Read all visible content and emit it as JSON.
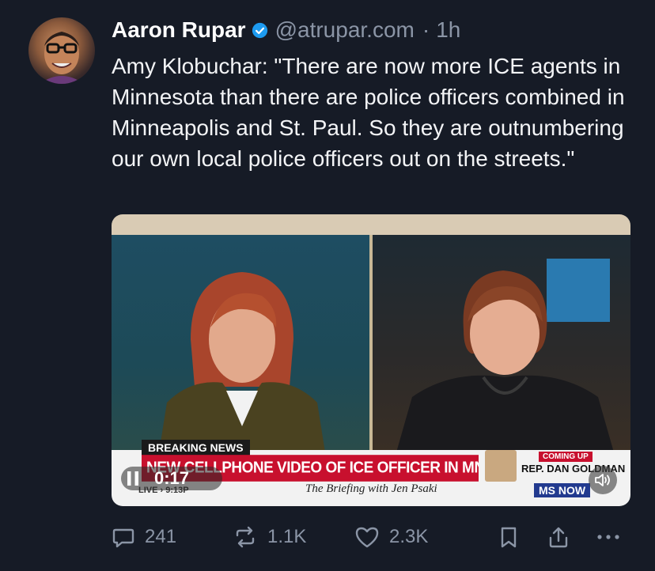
{
  "author": {
    "name": "Aaron Rupar",
    "handle": "@atrupar.com",
    "separator": "·",
    "time": "1h"
  },
  "tweet": {
    "text": "Amy Klobuchar: \"There are now more ICE agents in Minnesota than there are police officers combined in Minneapolis and St. Paul. So they are outnumbering our own local police officers out on the streets.\""
  },
  "video": {
    "breaking_label": "BREAKING NEWS",
    "headline": "NEW CELLPHONE VIDEO OF ICE OFFICER IN MN SHOOTING RELEASED",
    "live_label": "LIVE › 9:13P",
    "show_name": "The Briefing with Jen Psaki",
    "coming_up": "COMING UP",
    "coming_up_guest": "REP. DAN GOLDMAN",
    "network_logo": "MS NOW",
    "elapsed": "0:17"
  },
  "actions": {
    "replies": "241",
    "reposts": "1.1K",
    "likes": "2.3K"
  },
  "colors": {
    "background": "#161b26",
    "verified": "#1d9bf0",
    "muted_text": "#8b95a6",
    "headline_red": "#c8102e"
  }
}
